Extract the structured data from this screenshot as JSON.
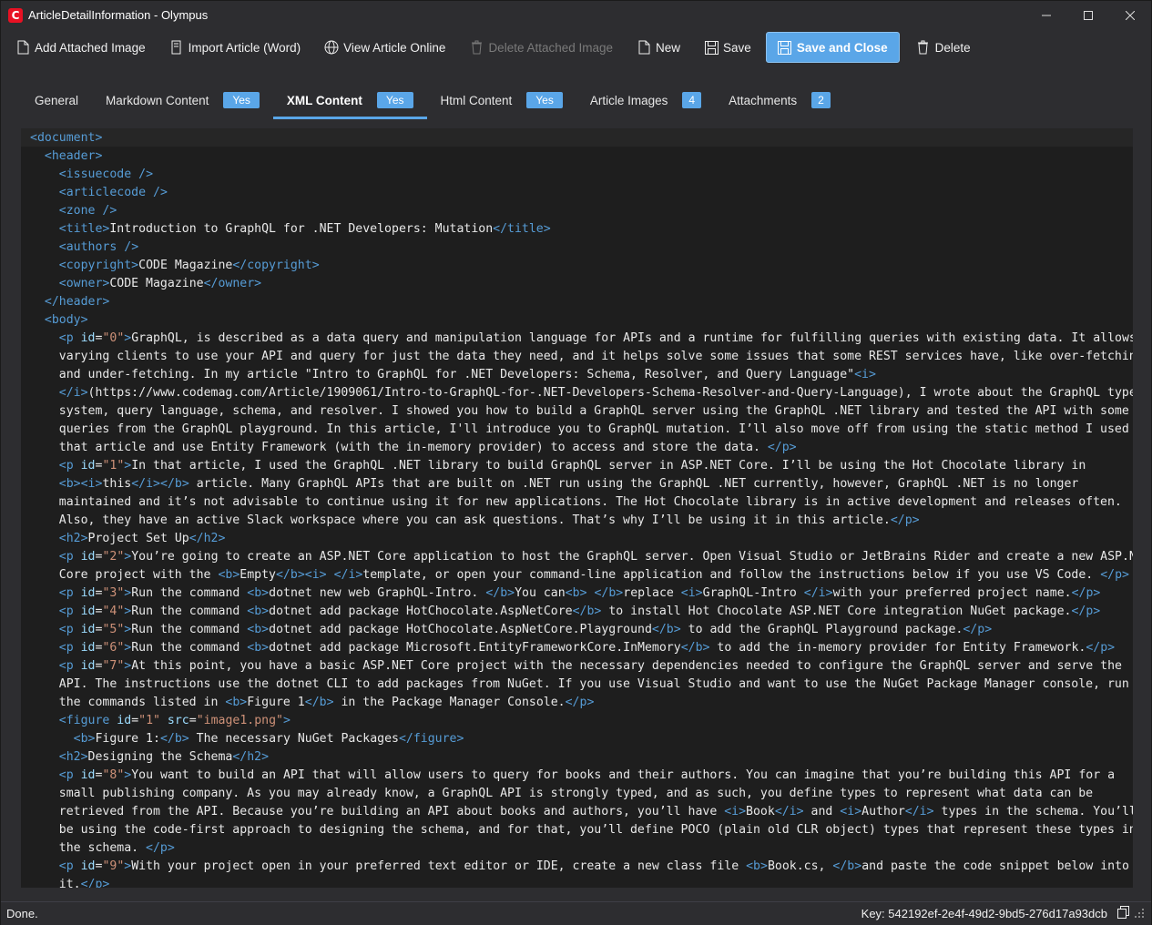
{
  "window": {
    "title": "ArticleDetailInformation - Olympus",
    "logo_letter": "C",
    "brand_color": "#e81123"
  },
  "toolbar": {
    "add_image": "Add Attached Image",
    "import_article": "Import Article (Word)",
    "view_online": "View Article Online",
    "delete_image": "Delete Attached Image",
    "new": "New",
    "save": "Save",
    "save_close": "Save and Close",
    "delete": "Delete"
  },
  "tabs": [
    {
      "label": "General",
      "badge": ""
    },
    {
      "label": "Markdown Content",
      "badge": "Yes"
    },
    {
      "label": "XML Content",
      "badge": "Yes",
      "active": true
    },
    {
      "label": "Html Content",
      "badge": "Yes"
    },
    {
      "label": "Article Images",
      "badge": "4"
    },
    {
      "label": "Attachments",
      "badge": "2"
    }
  ],
  "colors": {
    "accent": "#5aa6e8",
    "tag": "#569cd6",
    "attr": "#9cdcfe",
    "value": "#ce9178"
  },
  "editor_lines": [
    "<document>",
    "  <header>",
    "    <issuecode />",
    "    <articlecode />",
    "    <zone />",
    "    <title>Introduction to GraphQL for .NET Developers: Mutation</title>",
    "    <authors />",
    "    <copyright>CODE Magazine</copyright>",
    "    <owner>CODE Magazine</owner>",
    "  </header>",
    "  <body>",
    "    <p id=\"0\">GraphQL, is described as a data query and manipulation language for APIs and a runtime for fulfilling queries with existing data. It allows",
    "    varying clients to use your API and query for just the data they need, and it helps solve some issues that some REST services have, like over-fetching",
    "    and under-fetching. In my article \"Intro to GraphQL for .NET Developers: Schema, Resolver, and Query Language\"<i>",
    "    </i>(https://www.codemag.com/Article/1909061/Intro-to-GraphQL-for-.NET-Developers-Schema-Resolver-and-Query-Language), I wrote about the GraphQL type",
    "    system, query language, schema, and resolver. I showed you how to build a GraphQL server using the GraphQL .NET library and tested the API with some",
    "    queries from the GraphQL playground. In this article, I'll introduce you to GraphQL mutation. I’ll also move off from using the static method I used in",
    "    that article and use Entity Framework (with the in-memory provider) to access and store the data. </p>",
    "    <p id=\"1\">In that article, I used the GraphQL .NET library to build GraphQL server in ASP.NET Core. I’ll be using the Hot Chocolate library in",
    "    <b><i>this</i></b> article. Many GraphQL APIs that are built on .NET run using the GraphQL .NET currently, however, GraphQL .NET is no longer",
    "    maintained and it’s not advisable to continue using it for new applications. The Hot Chocolate library is in active development and releases often.",
    "    Also, they have an active Slack workspace where you can ask questions. That’s why I’ll be using it in this article.</p>",
    "    <h2>Project Set Up</h2>",
    "    <p id=\"2\">You’re going to create an ASP.NET Core application to host the GraphQL server. Open Visual Studio or JetBrains Rider and create a new ASP.NET",
    "    Core project with the <b>Empty</b><i> </i>template, or open your command-line application and follow the instructions below if you use VS Code. </p>",
    "    <p id=\"3\">Run the command <b>dotnet new web GraphQL-Intro. </b>You can<b> </b>replace <i>GraphQL-Intro </i>with your preferred project name.</p>",
    "    <p id=\"4\">Run the command <b>dotnet add package HotChocolate.AspNetCore</b> to install Hot Chocolate ASP.NET Core integration NuGet package.</p>",
    "    <p id=\"5\">Run the command <b>dotnet add package HotChocolate.AspNetCore.Playground</b> to add the GraphQL Playground package.</p>",
    "    <p id=\"6\">Run the command <b>dotnet add package Microsoft.EntityFrameworkCore.InMemory</b> to add the in-memory provider for Entity Framework.</p>",
    "    <p id=\"7\">At this point, you have a basic ASP.NET Core project with the necessary dependencies needed to configure the GraphQL server and serve the",
    "    API. The instructions use the dotnet CLI to add packages from NuGet. If you use Visual Studio and want to use the NuGet Package Manager console, run",
    "    the commands listed in <b>Figure 1</b> in the Package Manager Console.</p>",
    "    <figure id=\"1\" src=\"image1.png\">",
    "      <b>Figure 1:</b> The necessary NuGet Packages</figure>",
    "    <h2>Designing the Schema</h2>",
    "    <p id=\"8\">You want to build an API that will allow users to query for books and their authors. You can imagine that you’re building this API for a",
    "    small publishing company. As you may already know, a GraphQL API is strongly typed, and as such, you define types to represent what data can be",
    "    retrieved from the API. Because you’re building an API about books and authors, you’ll have <i>Book</i> and <i>Author</i> types in the schema. You’ll",
    "    be using the code-first approach to designing the schema, and for that, you’ll define POCO (plain old CLR object) types that represent these types in",
    "    the schema. </p>",
    "    <p id=\"9\">With your project open in your preferred text editor or IDE, create a new class file <b>Book.cs, </b>and paste the code snippet below into",
    "    it.</p>"
  ],
  "status": {
    "text": "Done.",
    "key": "Key: 542192ef-2e4f-49d2-9bd5-276d17a93dcb"
  }
}
